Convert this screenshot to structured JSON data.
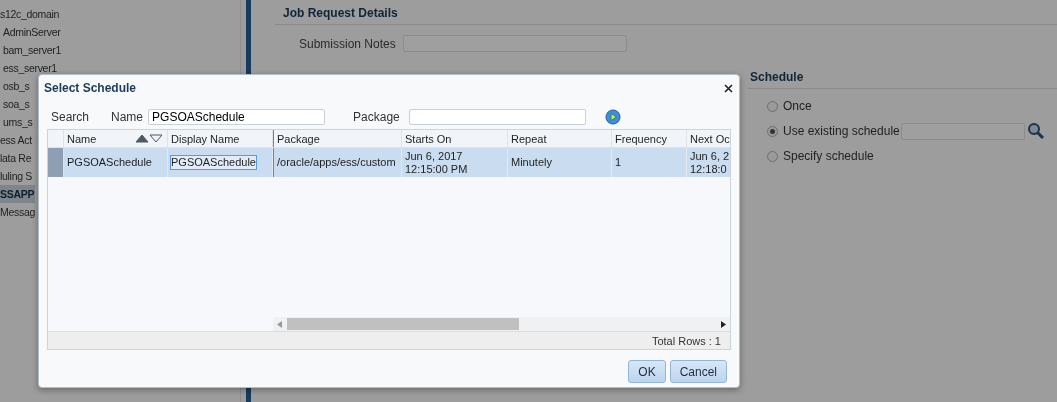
{
  "sidebar": {
    "items": [
      {
        "label": "s12c_domain",
        "selected": false,
        "children": [
          {
            "label": "AdminServer",
            "selected": false
          },
          {
            "label": "bam_server1",
            "selected": false
          },
          {
            "label": "ess_server1",
            "selected": false
          },
          {
            "label": "osb_s",
            "selected": false
          },
          {
            "label": "soa_s",
            "selected": false
          },
          {
            "label": "ums_s",
            "selected": false
          }
        ]
      },
      {
        "label": "ess Act",
        "selected": false
      },
      {
        "label": "lata Re",
        "selected": false
      },
      {
        "label": "luling S",
        "selected": false
      },
      {
        "label": "SSAPP",
        "selected": true
      },
      {
        "label": "Messag",
        "selected": false
      }
    ]
  },
  "job_request": {
    "title": "Job Request Details",
    "fields": [
      {
        "label": "Submission Notes"
      }
    ]
  },
  "schedule": {
    "title": "Schedule",
    "options": [
      {
        "label": "Once",
        "selected": false,
        "kind": "plain"
      },
      {
        "label": "Use existing schedule",
        "selected": true,
        "kind": "lookup"
      },
      {
        "label": "Specify schedule",
        "selected": false,
        "kind": "plain"
      }
    ]
  },
  "dialog": {
    "title": "Select Schedule",
    "search": {
      "label": "Search",
      "fields": [
        {
          "label": "Name",
          "value": "PGSOASchedule"
        },
        {
          "label": "Package"
        }
      ]
    },
    "table": {
      "columns": [
        {
          "label": "Name",
          "sorted_ascending": true
        },
        {
          "label": "Display Name"
        },
        {
          "label": "Package"
        },
        {
          "label": "Starts On"
        },
        {
          "label": "Repeat"
        },
        {
          "label": "Frequency"
        },
        {
          "label": "Next Oc"
        }
      ],
      "rows": [
        {
          "selected": true,
          "cells": [
            {
              "text": "PGSOASchedule",
              "focused": false
            },
            {
              "text": "PGSOASchedule",
              "focused": true
            },
            {
              "text": "/oracle/apps/ess/custom",
              "focused": false
            },
            {
              "text": "Jun 6, 2017\n12:15:00 PM",
              "focused": false
            },
            {
              "text": "Minutely",
              "focused": false
            },
            {
              "text": "1",
              "focused": false
            },
            {
              "text": "Jun 6, 2\n12:18:0",
              "focused": false
            }
          ]
        }
      ]
    },
    "footer": "Total Rows : 1",
    "buttons": [
      "OK",
      "Cancel"
    ]
  }
}
